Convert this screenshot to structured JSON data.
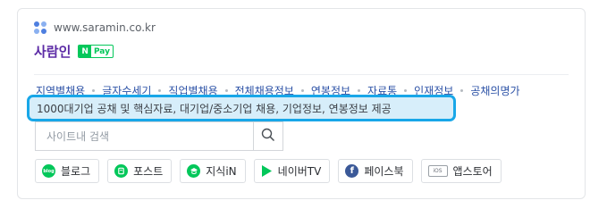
{
  "site": {
    "url": "www.saramin.co.kr",
    "name": "사람인",
    "npay": {
      "n": "N",
      "pay": "Pay"
    }
  },
  "links": [
    "지역별채용",
    "글자수세기",
    "직업별채용",
    "전체채용정보",
    "연봉정보",
    "자료통",
    "인재정보",
    "공채의명가"
  ],
  "description": "1000대기업 공채 및 핵심자료, 대기업/중소기업 채용, 기업정보, 연봉정보 제공",
  "search": {
    "placeholder": "사이트내 검색",
    "value": ""
  },
  "socials": [
    {
      "label": "블로그",
      "icon": "blog-icon",
      "icon_text": "blog",
      "color": "#03c75a"
    },
    {
      "label": "포스트",
      "icon": "post-icon",
      "icon_text": "",
      "color": "#03c75a"
    },
    {
      "label": "지식iN",
      "icon": "kin-icon",
      "icon_text": "",
      "color": "#03c75a"
    },
    {
      "label": "네이버TV",
      "icon": "navertv-icon",
      "icon_text": "",
      "color": "#03c75a"
    },
    {
      "label": "페이스북",
      "icon": "facebook-icon",
      "icon_text": "f",
      "color": "#3b5998"
    },
    {
      "label": "앱스토어",
      "icon": "appstore-icon",
      "icon_text": "iOS",
      "color": "#6b7079"
    }
  ],
  "colors": {
    "site_name": "#5b2aa5",
    "link": "#2b51a6",
    "highlight_border": "#18a7e8",
    "highlight_fill": "#d7eefa",
    "naver_green": "#03c75a"
  }
}
